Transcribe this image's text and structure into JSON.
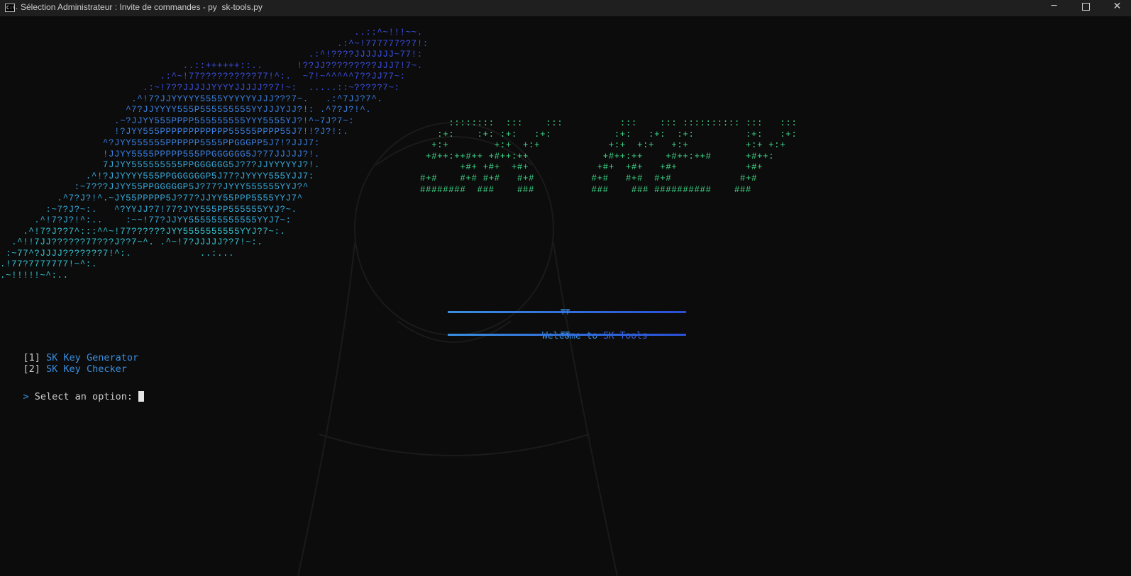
{
  "window": {
    "title": "Sélection Administrateur : Invite de commandes - py  sk-tools.py",
    "icon": "cmd-icon",
    "icon_text": "C:\\.",
    "buttons": {
      "minimize": "─",
      "close": "✕"
    }
  },
  "colors": {
    "background": "#0c0c0c",
    "art_gradient": [
      "#3b4fe0",
      "#3a7fe0",
      "#36a8d8",
      "#35c2cf"
    ],
    "logo": "#3fd98a",
    "text": "#cccccc",
    "accent": "#3a8fe0"
  },
  "art_lines": [
    "                                                              ..::^~!!!~~.",
    "                                                           .:^~!777777??7!:",
    "                                                      .:^!????JJJJJJJ~77!:",
    "                                ..::++++++::..      !??JJ?????????JJJ7!7~.",
    "                            .:^~!77??????????77!^:.  ~7!~^^^^^7??JJ77~:",
    "                         .:~!7??JJJJJYYYYJJJJJ??7!~:  .....::~?????7~:",
    "                       .^!7?JJYYYYY5555YYYYYYJJJ???7~.   .:^7JJ?7^.",
    "                      ^7?JJYYYY555P555555555YYJJJYJJ?!: .^7?J?!^.",
    "                    .~?JJYY555PPPP555555555YYY5555YJ?!^~7J?7~:",
    "                    !?JYY555PPPPPPPPPPPP55555PPPP55J7!!?J?!:.",
    "                  ^?JYY555555PPPPPP5555PPGGGPP5J7!?JJJ7:",
    "                  !JJYY5555PPPPP555PPGGGGGG5J?77JJJJJ?!.",
    "                  7JJYY555555555PPGGGGGG5J?7?JJYYYYYJ?!.",
    "               .^!?JJYYYY555PPGGGGGGP5J77?JYYYY555YJJ7:",
    "             :~7???JJYY55PPGGGGGP5J?77?JYYY555555YYJ?^",
    "          .^7?J?!^.~JY55PPPPP5J?77?JJYY55PPP5555YYJ7^",
    "        :~7?J?~:.   ^?YYJJ?7!77?JYY555PP555555YYJ?~.",
    "      .^!7?J?!^:..    :~~!77?JJYY555555555555YYJ7~:",
    "    .^!7?J??7^:::^^~!77??????JYY5555555555YYJ?7~:.",
    "  .^!!7JJ??????77???J??7~^. .^~!7?JJJJJ??7!~:.",
    " :~77^?JJJJ???????7!^:.            ..:...",
    ".!77?7777777!~^:.",
    ".~!!!!!~^:.."
  ],
  "logo_lines": [
    "     ::::::::  :::    :::          :::    ::: :::::::::: :::   :::",
    "   :+:    :+: :+:   :+:           :+:   :+:  :+:         :+:   :+:",
    "  +:+        +:+  +:+            +:+  +:+   +:+          +:+ +:+",
    " +#++:++#++ +#++:++             +#++:++    +#++:++#      +#++:",
    "       +#+ +#+  +#+            +#+  +#+   +#+            +#+",
    "#+#    #+# #+#   #+#          #+#   #+#  #+#            #+#",
    "########  ###    ###          ###    ### ##########    ###"
  ],
  "banner": {
    "ornament": "₸₸",
    "welcome_prefix": "Welcome to ",
    "welcome_name": "SK Tools"
  },
  "menu": [
    {
      "key": "[1]",
      "label": "SK Key Generator"
    },
    {
      "key": "[2]",
      "label": "SK Key Checker"
    }
  ],
  "prompt": {
    "symbol": ">",
    "text": " Select an option:"
  }
}
